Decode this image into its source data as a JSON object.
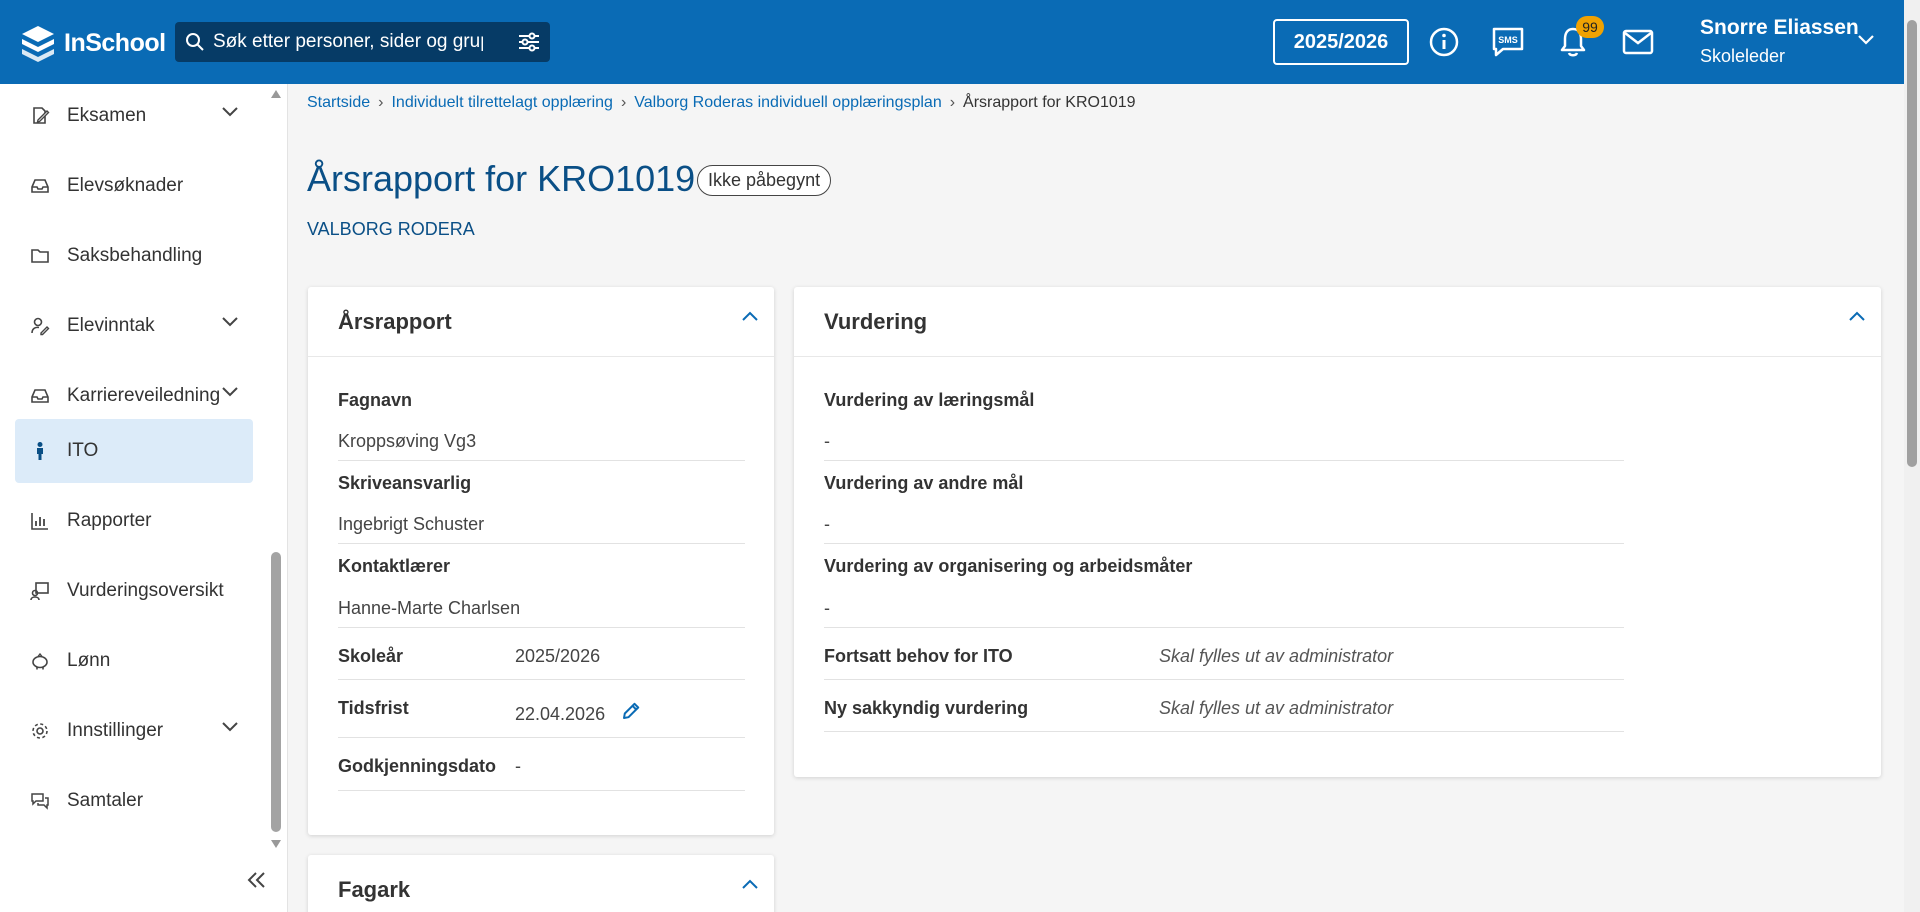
{
  "header": {
    "logo_text": "InSchool",
    "search_placeholder": "Søk etter personer, sider og grupper",
    "school_year": "2025/2026",
    "notification_count": "99",
    "user_name": "Snorre Eliassen",
    "user_role": "Skoleleder",
    "sms_label": "SMS",
    "brand_color": "#0a6bb5"
  },
  "sidebar": {
    "items": [
      {
        "label": "Eksamen",
        "icon": "exam-icon"
      },
      {
        "label": "Elevsøknader",
        "icon": "inbox-icon"
      },
      {
        "label": "Saksbehandling",
        "icon": "folder-icon"
      },
      {
        "label": "Elevinntak",
        "icon": "user-edit-icon"
      },
      {
        "label": "Karriereveiledning",
        "icon": "inbox-icon"
      },
      {
        "label": "ITO",
        "icon": "person-icon"
      },
      {
        "label": "Rapporter",
        "icon": "chart-icon"
      },
      {
        "label": "Vurderingsoversikt",
        "icon": "assessment-icon"
      },
      {
        "label": "Lønn",
        "icon": "piggy-bank-icon"
      },
      {
        "label": "Innstillinger",
        "icon": "gear-icon"
      },
      {
        "label": "Samtaler",
        "icon": "chat-icon"
      }
    ],
    "active_item": "ITO"
  },
  "breadcrumb": {
    "items": [
      "Startside",
      "Individuelt tilrettelagt opplæring",
      "Valborg Roderas individuell opplæringsplan"
    ],
    "current": "Årsrapport for KRO1019"
  },
  "page": {
    "title": "Årsrapport for KRO1019",
    "status": "Ikke påbegynt",
    "student": "VALBORG RODERA"
  },
  "arsrapport": {
    "title": "Årsrapport",
    "fagnavn_label": "Fagnavn",
    "fagnavn_value": "Kroppsøving Vg3",
    "skriveansvarlig_label": "Skriveansvarlig",
    "skriveansvarlig_value": "Ingebrigt Schuster",
    "kontaktlaerer_label": "Kontaktlærer",
    "kontaktlaerer_value": "Hanne-Marte Charlsen",
    "skolear_label": "Skoleår",
    "skolear_value": "2025/2026",
    "tidsfrist_label": "Tidsfrist",
    "tidsfrist_value": "22.04.2026",
    "godkjenning_label": "Godkjenningsdato",
    "godkjenning_value": "-"
  },
  "vurdering": {
    "title": "Vurdering",
    "laeringsmal_label": "Vurdering av læringsmål",
    "laeringsmal_value": "-",
    "andre_mal_label": "Vurdering av andre mål",
    "andre_mal_value": "-",
    "organisering_label": "Vurdering av organisering og arbeidsmåter",
    "organisering_value": "-",
    "fortsatt_label": "Fortsatt behov for ITO",
    "fortsatt_value": "Skal fylles ut av administrator",
    "sakkyndig_label": "Ny sakkyndig vurdering",
    "sakkyndig_value": "Skal fylles ut av administrator"
  },
  "fagark": {
    "title": "Fagark"
  }
}
